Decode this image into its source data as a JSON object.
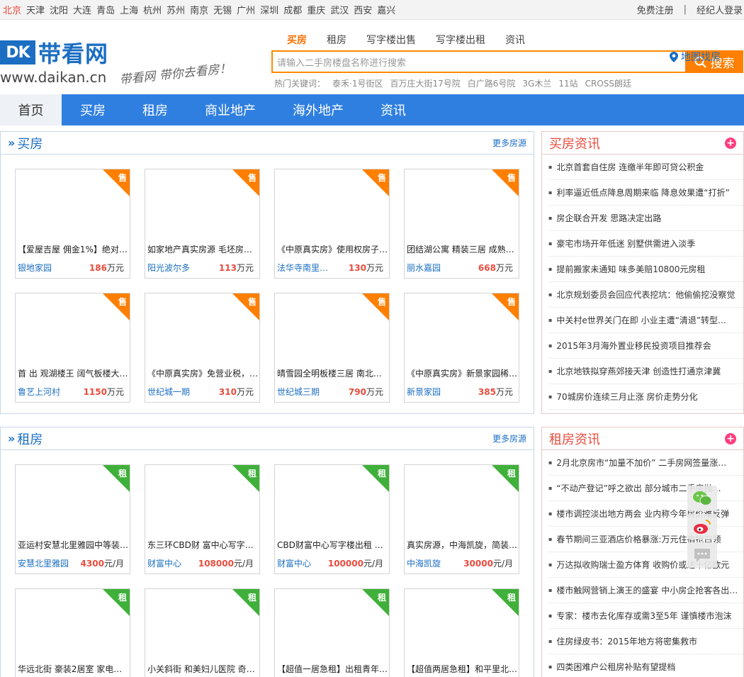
{
  "cities": [
    "北京",
    "天津",
    "沈阳",
    "大连",
    "青岛",
    "上海",
    "杭州",
    "苏州",
    "南京",
    "无锡",
    "广州",
    "深圳",
    "成都",
    "重庆",
    "武汉",
    "西安",
    "嘉兴"
  ],
  "active_city": "北京",
  "userlinks": {
    "register": "免费注册",
    "sep": "|",
    "agent_login": "经纪人登录"
  },
  "logo": {
    "mark": "DK",
    "name": "带看网",
    "url": "www.daikan.cn",
    "slogan": "带看网 带你去看房！"
  },
  "search": {
    "tabs": [
      "买房",
      "租房",
      "写字楼出售",
      "写字楼出租",
      "资讯"
    ],
    "active_tab": "买房",
    "map_link": "地图找房",
    "placeholder": "请输入二手房楼盘名称进行搜索",
    "button": "搜索",
    "hot_label": "热门关键词：",
    "hot_keywords": [
      "泰禾·1号街区",
      "百万庄大街17号院",
      "白广路6号院",
      "3G木兰",
      "11站",
      "CROSS朗廷"
    ]
  },
  "nav": [
    "首页",
    "买房",
    "租房",
    "商业地产",
    "海外地产",
    "资讯"
  ],
  "buy": {
    "title": "买房",
    "more": "更多房源",
    "badge": "售",
    "unit": "万元",
    "cards": [
      {
        "title": "【爱屋吉屋 佣金1%】绝对…",
        "area": "银地家园",
        "price": "186"
      },
      {
        "title": "如家地产真实房源 毛坯房…",
        "area": "阳光波尔多",
        "price": "113"
      },
      {
        "title": "《中原真实房》使用权房子…",
        "area": "法华寺南里…",
        "price": "130"
      },
      {
        "title": "团结湖公寓 精装三居 成熟…",
        "area": "丽水嘉园",
        "price": "668"
      },
      {
        "title": "首 出 观湖楼王 阔气板楼大…",
        "area": "鲁艺上河村",
        "price": "1150"
      },
      {
        "title": "《中原真实房》免营业税，…",
        "area": "世纪城一期",
        "price": "310"
      },
      {
        "title": "晴雪园全明板楼三居 南北…",
        "area": "世纪城三期",
        "price": "790"
      },
      {
        "title": "《中原真实房》新景家园稀…",
        "area": "新景家园",
        "price": "385"
      }
    ]
  },
  "rent": {
    "title": "租房",
    "more": "更多房源",
    "badge": "租",
    "unit": "元/月",
    "cards": [
      {
        "title": "亚运村安慧北里雅园中等装…",
        "area": "安慧北里雅园",
        "price": "4300"
      },
      {
        "title": "东三环CBD财 富中心写字…",
        "area": "财富中心",
        "price": "108000"
      },
      {
        "title": "CBD财富中心写字楼出租 …",
        "area": "财富中心",
        "price": "100000"
      },
      {
        "title": "真实房源，中海凯旋，简装…",
        "area": "中海凯旋",
        "price": "30000"
      },
      {
        "title": "华远北街 豪装2居室 家电…",
        "area": "",
        "price": ""
      },
      {
        "title": "小关斜街 和美妇儿医院 奇…",
        "area": "",
        "price": ""
      },
      {
        "title": "【超值一居急租】出租青年…",
        "area": "",
        "price": ""
      },
      {
        "title": "【超值两居急租】和平里北…",
        "area": "",
        "price": ""
      }
    ]
  },
  "buy_news": {
    "title": "买房资讯",
    "items": [
      "北京首套自住房 连缴半年即可贷公积金",
      "利率逼近低点降息周期来临 降息效果遭“打折”",
      "房企联合开发 思路决定出路",
      "豪宅市场开年低迷 别墅供需进入淡季",
      "提前搬家未通知 味多美赔10800元房租",
      "北京规划委员会回应代表挖坑：他偷偷挖没察觉",
      "中关村e世界关门在即 小业主遭“清退”转型…",
      "2015年3月海外置业移民投资项目推荐会",
      "北京地铁拟穿燕郊接天津 创造性打通京津冀",
      "70城房价连续三月止涨 房价走势分化"
    ]
  },
  "rent_news": {
    "title": "租房资讯",
    "items": [
      "2月北京房市“加量不加价” 二手房网签量涨…",
      "“不动产登记”呼之欲出 部分城市二手房抛…",
      "楼市调控淡出地方两会 业内称今年房价难反弹",
      "春节期间三亚酒店价格暴涨:万元住宿抢白领",
      "万达拟收购瑞士盈方体育 收购价或达十亿欧元",
      "楼市触网营销上演王的盛宴 中小房企抢客各出…",
      "专家：楼市去化库存或需3至5年 谨慎楼市泡沫",
      "住房绿皮书：2015年地方将密集救市",
      "四类困难户公租房补贴有望提档"
    ]
  },
  "colors": {
    "brand_blue": "#2f7fe0",
    "orange": "#ff7f00",
    "rent_green": "#3fb03a",
    "price_red": "#e84c3d"
  }
}
